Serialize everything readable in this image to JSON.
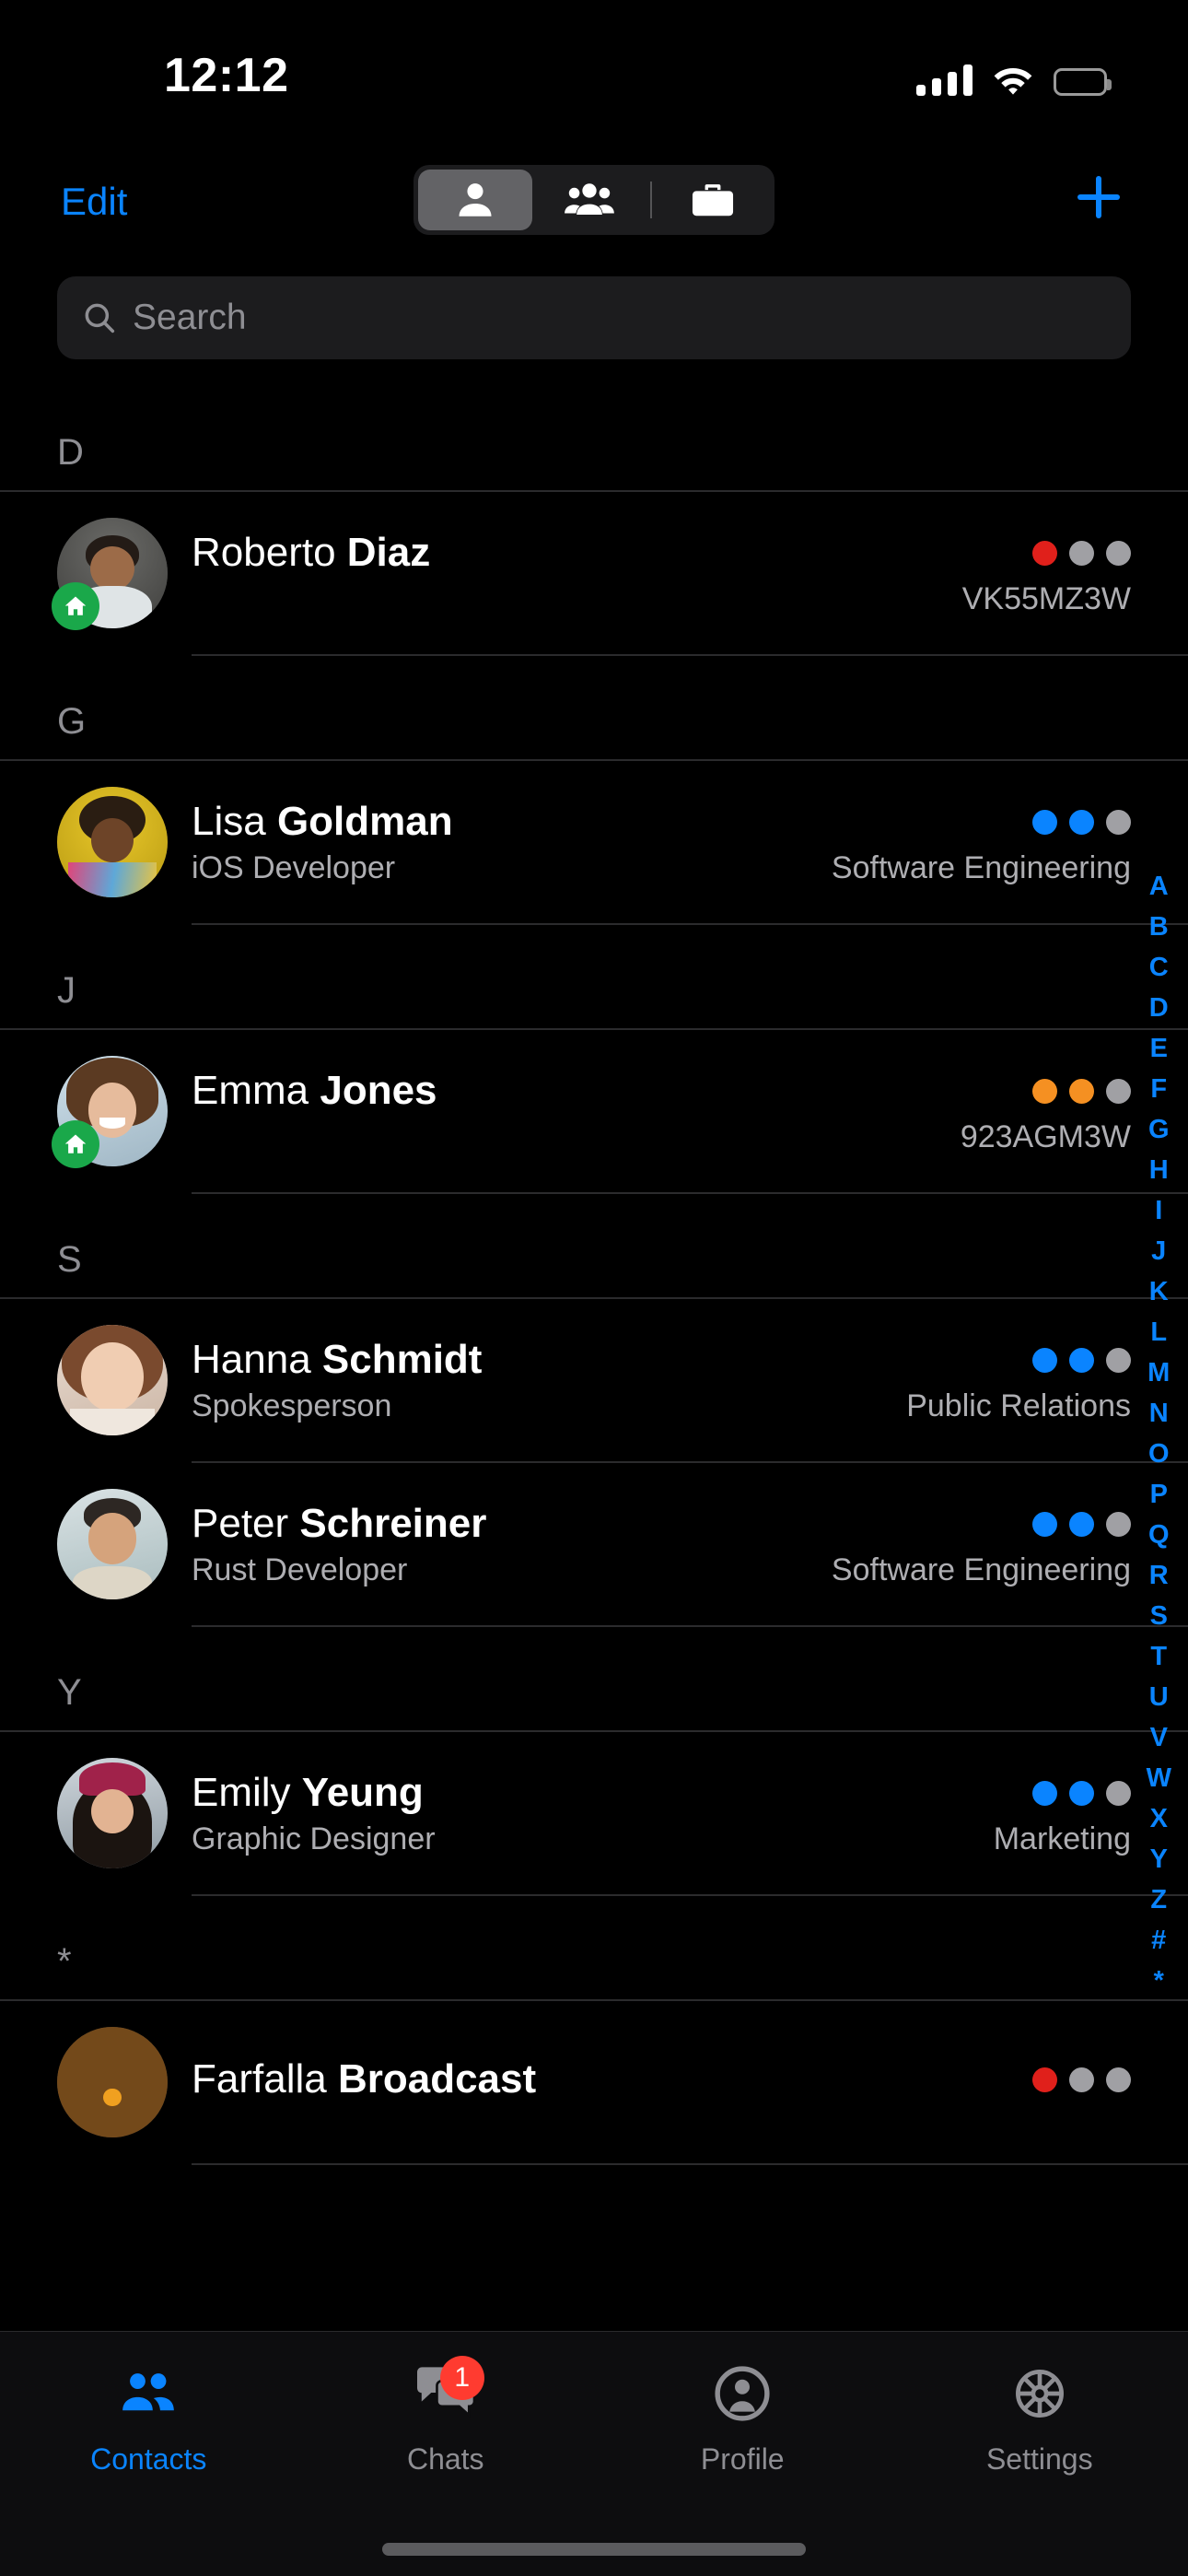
{
  "status_bar": {
    "time": "12:12",
    "icons": [
      "cellular-signal-icon",
      "wifi-icon",
      "battery-icon"
    ]
  },
  "nav_bar": {
    "edit_label": "Edit",
    "add_label": "+",
    "segments": [
      {
        "name": "person-segment",
        "icon": "person-icon",
        "selected": true
      },
      {
        "name": "group-segment",
        "icon": "people-group-icon",
        "selected": false
      },
      {
        "name": "work-segment",
        "icon": "briefcase-icon",
        "selected": false
      }
    ]
  },
  "search": {
    "placeholder": "Search",
    "value": "",
    "icon": "search-icon"
  },
  "sections": [
    {
      "letter": "D",
      "contacts": [
        {
          "given": "Roberto ",
          "family": "Diaz",
          "subtitle": "",
          "meta": "VK55MZ3W",
          "dots": [
            "#e0201b",
            "#a0a0a4",
            "#a0a0a4"
          ],
          "badge": "home-badge-icon",
          "avatar": "photo-roberto-diaz"
        }
      ]
    },
    {
      "letter": "G",
      "contacts": [
        {
          "given": "Lisa ",
          "family": "Goldman",
          "subtitle": "iOS Developer",
          "meta": "Software Engineering",
          "dots": [
            "#0a84ff",
            "#0a84ff",
            "#a0a0a4"
          ],
          "badge": "",
          "avatar": "photo-lisa-goldman"
        }
      ]
    },
    {
      "letter": "J",
      "contacts": [
        {
          "given": "Emma ",
          "family": "Jones",
          "subtitle": "",
          "meta": "923AGM3W",
          "dots": [
            "#f59022",
            "#f59022",
            "#a0a0a4"
          ],
          "badge": "home-badge-icon",
          "avatar": "photo-emma-jones"
        }
      ]
    },
    {
      "letter": "S",
      "contacts": [
        {
          "given": "Hanna ",
          "family": "Schmidt",
          "subtitle": "Spokesperson",
          "meta": "Public Relations",
          "dots": [
            "#0a84ff",
            "#0a84ff",
            "#a0a0a4"
          ],
          "badge": "",
          "avatar": "photo-hanna-schmidt"
        },
        {
          "given": "Peter ",
          "family": "Schreiner",
          "subtitle": "Rust Developer",
          "meta": "Software Engineering",
          "dots": [
            "#0a84ff",
            "#0a84ff",
            "#a0a0a4"
          ],
          "badge": "",
          "avatar": "photo-peter-schreiner"
        }
      ]
    },
    {
      "letter": "Y",
      "contacts": [
        {
          "given": "Emily ",
          "family": "Yeung",
          "subtitle": "Graphic Designer",
          "meta": "Marketing",
          "dots": [
            "#0a84ff",
            "#0a84ff",
            "#a0a0a4"
          ],
          "badge": "",
          "avatar": "photo-emily-yeung"
        }
      ]
    },
    {
      "letter": "*",
      "contacts": [
        {
          "given": "Farfalla ",
          "family": "Broadcast",
          "subtitle": "",
          "meta": "",
          "dots": [
            "#e0201b",
            "#a0a0a4",
            "#a0a0a4"
          ],
          "badge": "",
          "avatar": "photo-farfalla-broadcast"
        }
      ]
    }
  ],
  "alpha_index": [
    "A",
    "B",
    "C",
    "D",
    "E",
    "F",
    "G",
    "H",
    "I",
    "J",
    "K",
    "L",
    "M",
    "N",
    "O",
    "P",
    "Q",
    "R",
    "S",
    "T",
    "U",
    "V",
    "W",
    "X",
    "Y",
    "Z",
    "#",
    "*"
  ],
  "tab_bar": {
    "tabs": [
      {
        "label": "Contacts",
        "icon": "contacts-people-icon",
        "active": true,
        "badge": ""
      },
      {
        "label": "Chats",
        "icon": "chat-bubbles-icon",
        "active": false,
        "badge": "1"
      },
      {
        "label": "Profile",
        "icon": "profile-person-icon",
        "active": false,
        "badge": ""
      },
      {
        "label": "Settings",
        "icon": "gear-icon",
        "active": false,
        "badge": ""
      }
    ]
  },
  "colors": {
    "accent": "#0a84ff",
    "background": "#000000",
    "field": "#1c1c1e",
    "separator": "#2b2b2d",
    "secondary_text": "#8e8e93",
    "status_red": "#e0201b",
    "status_orange": "#f59022",
    "status_gray": "#a0a0a4",
    "badge_red": "#ff3b30",
    "home_badge_green": "#1aa84a"
  }
}
